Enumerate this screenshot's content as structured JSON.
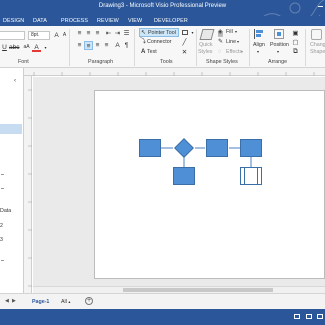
{
  "window": {
    "title": "Drawing3 - Microsoft Visio Professional Preview"
  },
  "tabs": [
    "DESIGN",
    "DATA",
    "PROCESS",
    "REVIEW",
    "VIEW",
    "DEVELOPER"
  ],
  "ribbon": {
    "font_size": "8pt.",
    "groups": {
      "font": "Font",
      "paragraph": "Paragraph",
      "tools": "Tools",
      "shape_styles": "Shape Styles",
      "arrange": "Arrange"
    },
    "tools": {
      "pointer": "Pointer Tool",
      "connector": "Connector",
      "text": "Text"
    },
    "styles": {
      "fill": "Fill",
      "line": "Line",
      "effects": "Effects",
      "quick_styles_1": "Quick",
      "quick_styles_2": "Styles"
    },
    "arrange": {
      "align": "Align",
      "position": "Position",
      "change_shape_1": "Change",
      "change_shape_2": "Shape"
    }
  },
  "left_pane": {
    "items": [
      "Data",
      "2",
      "3"
    ]
  },
  "page_tabs": {
    "page1": "Page-1",
    "all": "All"
  },
  "colors": {
    "accent": "#2b579a",
    "shape_fill": "#4f8fd5"
  }
}
